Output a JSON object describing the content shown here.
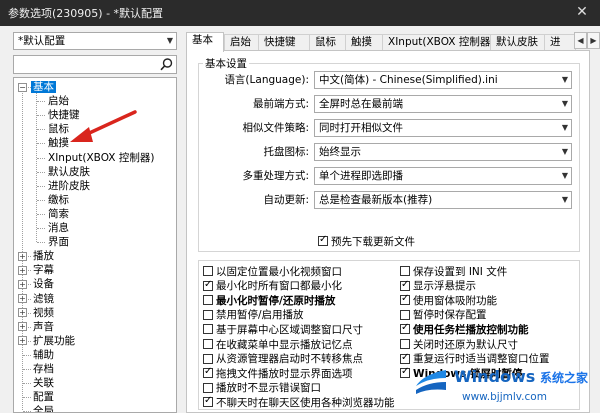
{
  "window": {
    "title": "参数选项(230905) - *默认配置",
    "close_glyph": "✕"
  },
  "left": {
    "preset": "*默认配置",
    "search_value": "",
    "tree": [
      {
        "label": "基本",
        "level": 0,
        "expander": "−",
        "selected": true
      },
      {
        "label": "启始",
        "level": 1
      },
      {
        "label": "快捷键",
        "level": 1
      },
      {
        "label": "鼠标",
        "level": 1
      },
      {
        "label": "触摸",
        "level": 1
      },
      {
        "label": "XInput(XBOX 控制器)",
        "level": 1
      },
      {
        "label": "默认皮肤",
        "level": 1
      },
      {
        "label": "进阶皮肤",
        "level": 1
      },
      {
        "label": "缴标",
        "level": 1
      },
      {
        "label": "简索",
        "level": 1
      },
      {
        "label": "消息",
        "level": 1
      },
      {
        "label": "界面",
        "level": 1
      },
      {
        "label": "播放",
        "level": 0,
        "expander": "+"
      },
      {
        "label": "字幕",
        "level": 0,
        "expander": "+"
      },
      {
        "label": "设备",
        "level": 0,
        "expander": "+"
      },
      {
        "label": "滤镜",
        "level": 0,
        "expander": "+"
      },
      {
        "label": "视频",
        "level": 0,
        "expander": "+"
      },
      {
        "label": "声音",
        "level": 0,
        "expander": "+"
      },
      {
        "label": "扩展功能",
        "level": 0,
        "expander": "+"
      },
      {
        "label": "辅助",
        "level": 0
      },
      {
        "label": "存档",
        "level": 0
      },
      {
        "label": "关联",
        "level": 0
      },
      {
        "label": "配置",
        "level": 0
      },
      {
        "label": "全局",
        "level": 0
      }
    ]
  },
  "tabs": [
    {
      "label": "基本",
      "active": true
    },
    {
      "label": "启始"
    },
    {
      "label": "快捷键"
    },
    {
      "label": "鼠标"
    },
    {
      "label": "触摸"
    },
    {
      "label": "XInput(XBOX 控制器)"
    },
    {
      "label": "默认皮肤"
    },
    {
      "label": "进"
    }
  ],
  "tab_nav": {
    "left": "◀",
    "right": "▶"
  },
  "basic": {
    "group_title": "基本设置",
    "fields": [
      {
        "label": "语言(Language):",
        "value": "中文(简体) - Chinese(Simplified).ini"
      },
      {
        "label": "最前端方式:",
        "value": "全屏时总在最前端"
      },
      {
        "label": "相似文件策略:",
        "value": "同时打开相似文件"
      },
      {
        "label": "托盘图标:",
        "value": "始终显示"
      },
      {
        "label": "多重处理方式:",
        "value": "单个进程即选即播"
      },
      {
        "label": "自动更新:",
        "value": "总是检查最新版本(推荐)"
      }
    ],
    "predownload": {
      "label": "预先下载更新文件",
      "checked": true
    }
  },
  "options_left": [
    {
      "label": "以固定位置最小化视频窗口",
      "checked": false
    },
    {
      "label": "最小化时所有窗口都最小化",
      "checked": true
    },
    {
      "label": "最小化时暂停/还原时播放",
      "checked": false,
      "bold": true
    },
    {
      "label": "禁用暂停/启用播放",
      "checked": false
    },
    {
      "label": "基于屏幕中心区域调整窗口尺寸",
      "checked": false
    },
    {
      "label": "在收藏菜单中显示播放记忆点",
      "checked": false
    },
    {
      "label": "从资源管理器启动时不转移焦点",
      "checked": false
    },
    {
      "label": "拖拽文件播放时显示界面选项",
      "checked": true
    },
    {
      "label": "播放时不显示错误窗口",
      "checked": false
    },
    {
      "label": "不聊天时在聊天区使用各种浏览器功能",
      "checked": true
    }
  ],
  "options_right": [
    {
      "label": "保存设置到 INI 文件",
      "checked": false
    },
    {
      "label": "显示浮悬提示",
      "checked": true
    },
    {
      "label": "使用窗体吸附功能",
      "checked": true
    },
    {
      "label": "暂停时保存配置",
      "checked": false
    },
    {
      "label": "使用任务栏播放控制功能",
      "checked": true,
      "bold": true
    },
    {
      "label": "关闭时还原为默认尺寸",
      "checked": false
    },
    {
      "label": "重复运行时适当调整窗口位置",
      "checked": true
    },
    {
      "label": "Windows 锁屏时暂停",
      "checked": true,
      "bold": true
    }
  ],
  "watermark": {
    "brand": "Windows",
    "tagline": "系统之家",
    "url": "www.bjjmlv.com"
  },
  "colors": {
    "selection": "#0078d7",
    "annotation_arrow": "#d9251d",
    "titlebar": "#2b2b2b"
  }
}
